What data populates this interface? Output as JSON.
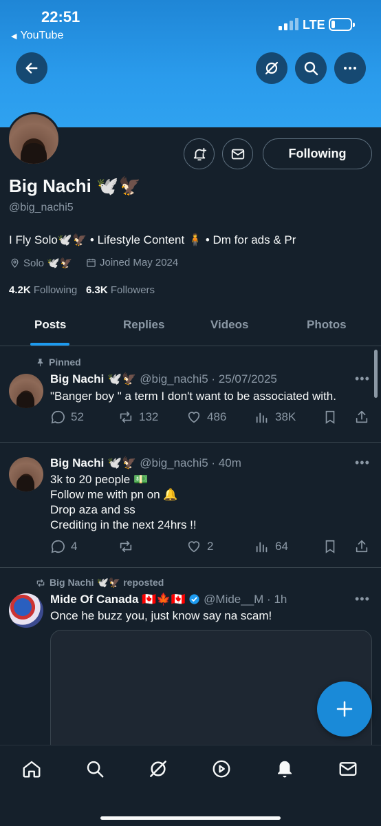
{
  "status": {
    "time": "22:51",
    "back_app": "YouTube",
    "network": "LTE"
  },
  "profile": {
    "name": "Big Nachi 🕊️🦅",
    "handle": "@big_nachi5",
    "bio": "I Fly Solo🕊️🦅 • Lifestyle Content 🧍 • Dm for ads & Pr",
    "location": "Solo 🕊️🦅",
    "joined": "Joined May 2024",
    "following_count": "4.2K",
    "following_label": "Following",
    "followers_count": "6.3K",
    "followers_label": "Followers",
    "follow_button": "Following"
  },
  "tabs": [
    {
      "label": "Posts"
    },
    {
      "label": "Replies"
    },
    {
      "label": "Videos"
    },
    {
      "label": "Photos"
    }
  ],
  "posts": [
    {
      "pinned_label": "Pinned",
      "name": "Big Nachi 🕊️🦅",
      "meta": "@big_nachi5 · 25/07/2025",
      "text": "\"Banger boy \" a term I don't want to be associated with.",
      "replies": "52",
      "reposts": "132",
      "likes": "486",
      "views": "38K"
    },
    {
      "name": "Big Nachi 🕊️🦅",
      "meta": "@big_nachi5 · 40m",
      "lines": [
        "3k to 20 people 💵",
        "Follow me with pn on 🔔",
        "Drop aza and ss",
        "Crediting in the next 24hrs !!"
      ],
      "replies": "4",
      "reposts": "",
      "likes": "2",
      "views": "64"
    },
    {
      "repost_label": "Big Nachi 🕊️🦅 reposted",
      "name": "Mide Of Canada 🇨🇦🍁🇨🇦",
      "meta": "@Mide__M · 1h",
      "text": "Once he buzz you, just know say na scam!"
    }
  ],
  "colors": {
    "accent": "#1d9bf0",
    "background": "#15202b",
    "muted": "#8b98a5"
  }
}
